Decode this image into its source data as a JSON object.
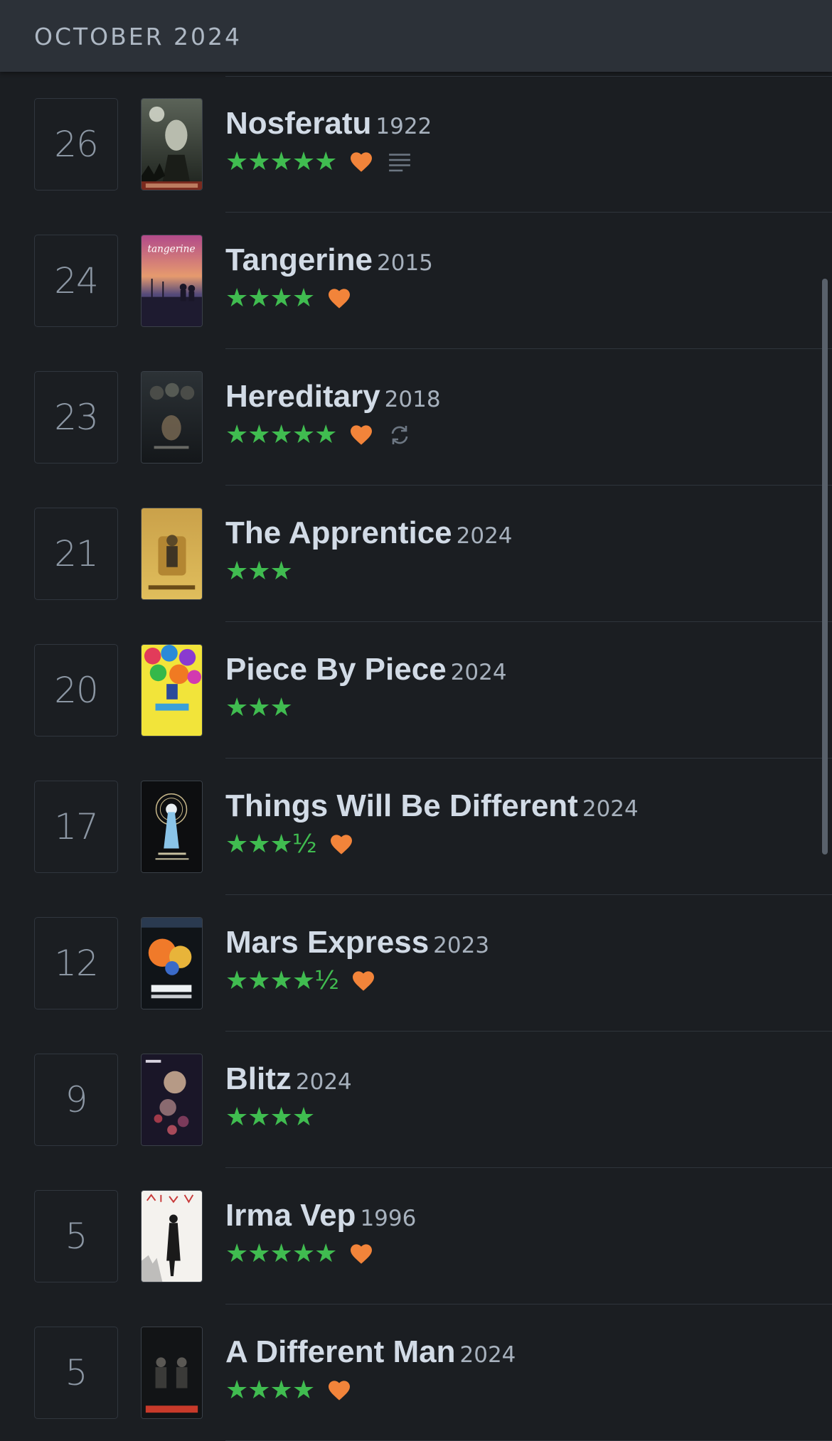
{
  "header": {
    "month": "OCTOBER 2024"
  },
  "colors": {
    "background": "#1b1e22",
    "header_bg": "#2c3138",
    "star_green": "#52d660",
    "heart_orange": "#f2843a",
    "title_text": "#d2dbe6"
  },
  "entries": [
    {
      "day": "26",
      "title": "Nosferatu",
      "year": "1922",
      "stars": "★★★★★",
      "rating": 5,
      "liked": true,
      "review": true,
      "rewatch": false,
      "poster_icon": "poster-nosferatu"
    },
    {
      "day": "24",
      "title": "Tangerine",
      "year": "2015",
      "stars": "★★★★",
      "rating": 4,
      "liked": true,
      "review": false,
      "rewatch": false,
      "poster_icon": "poster-tangerine"
    },
    {
      "day": "23",
      "title": "Hereditary",
      "year": "2018",
      "stars": "★★★★★",
      "rating": 5,
      "liked": true,
      "review": false,
      "rewatch": true,
      "poster_icon": "poster-hereditary"
    },
    {
      "day": "21",
      "title": "The Apprentice",
      "year": "2024",
      "stars": "★★★",
      "rating": 3,
      "liked": false,
      "review": false,
      "rewatch": false,
      "poster_icon": "poster-the-apprentice"
    },
    {
      "day": "20",
      "title": "Piece By Piece",
      "year": "2024",
      "stars": "★★★",
      "rating": 3,
      "liked": false,
      "review": false,
      "rewatch": false,
      "poster_icon": "poster-piece-by-piece"
    },
    {
      "day": "17",
      "title": "Things Will Be Different",
      "year": "2024",
      "stars": "★★★½",
      "rating": 3.5,
      "liked": true,
      "review": false,
      "rewatch": false,
      "poster_icon": "poster-things-will-be-different"
    },
    {
      "day": "12",
      "title": "Mars Express",
      "year": "2023",
      "stars": "★★★★½",
      "rating": 4.5,
      "liked": true,
      "review": false,
      "rewatch": false,
      "poster_icon": "poster-mars-express"
    },
    {
      "day": "9",
      "title": "Blitz",
      "year": "2024",
      "stars": "★★★★",
      "rating": 4,
      "liked": false,
      "review": false,
      "rewatch": false,
      "poster_icon": "poster-blitz"
    },
    {
      "day": "5",
      "title": "Irma Vep",
      "year": "1996",
      "stars": "★★★★★",
      "rating": 5,
      "liked": true,
      "review": false,
      "rewatch": false,
      "poster_icon": "poster-irma-vep"
    },
    {
      "day": "5",
      "title": "A Different Man",
      "year": "2024",
      "stars": "★★★★",
      "rating": 4,
      "liked": true,
      "review": false,
      "rewatch": false,
      "poster_icon": "poster-a-different-man"
    }
  ],
  "icons": {
    "liked": "heart-icon",
    "review": "review-lines-icon",
    "rewatch": "rewatch-icon"
  }
}
